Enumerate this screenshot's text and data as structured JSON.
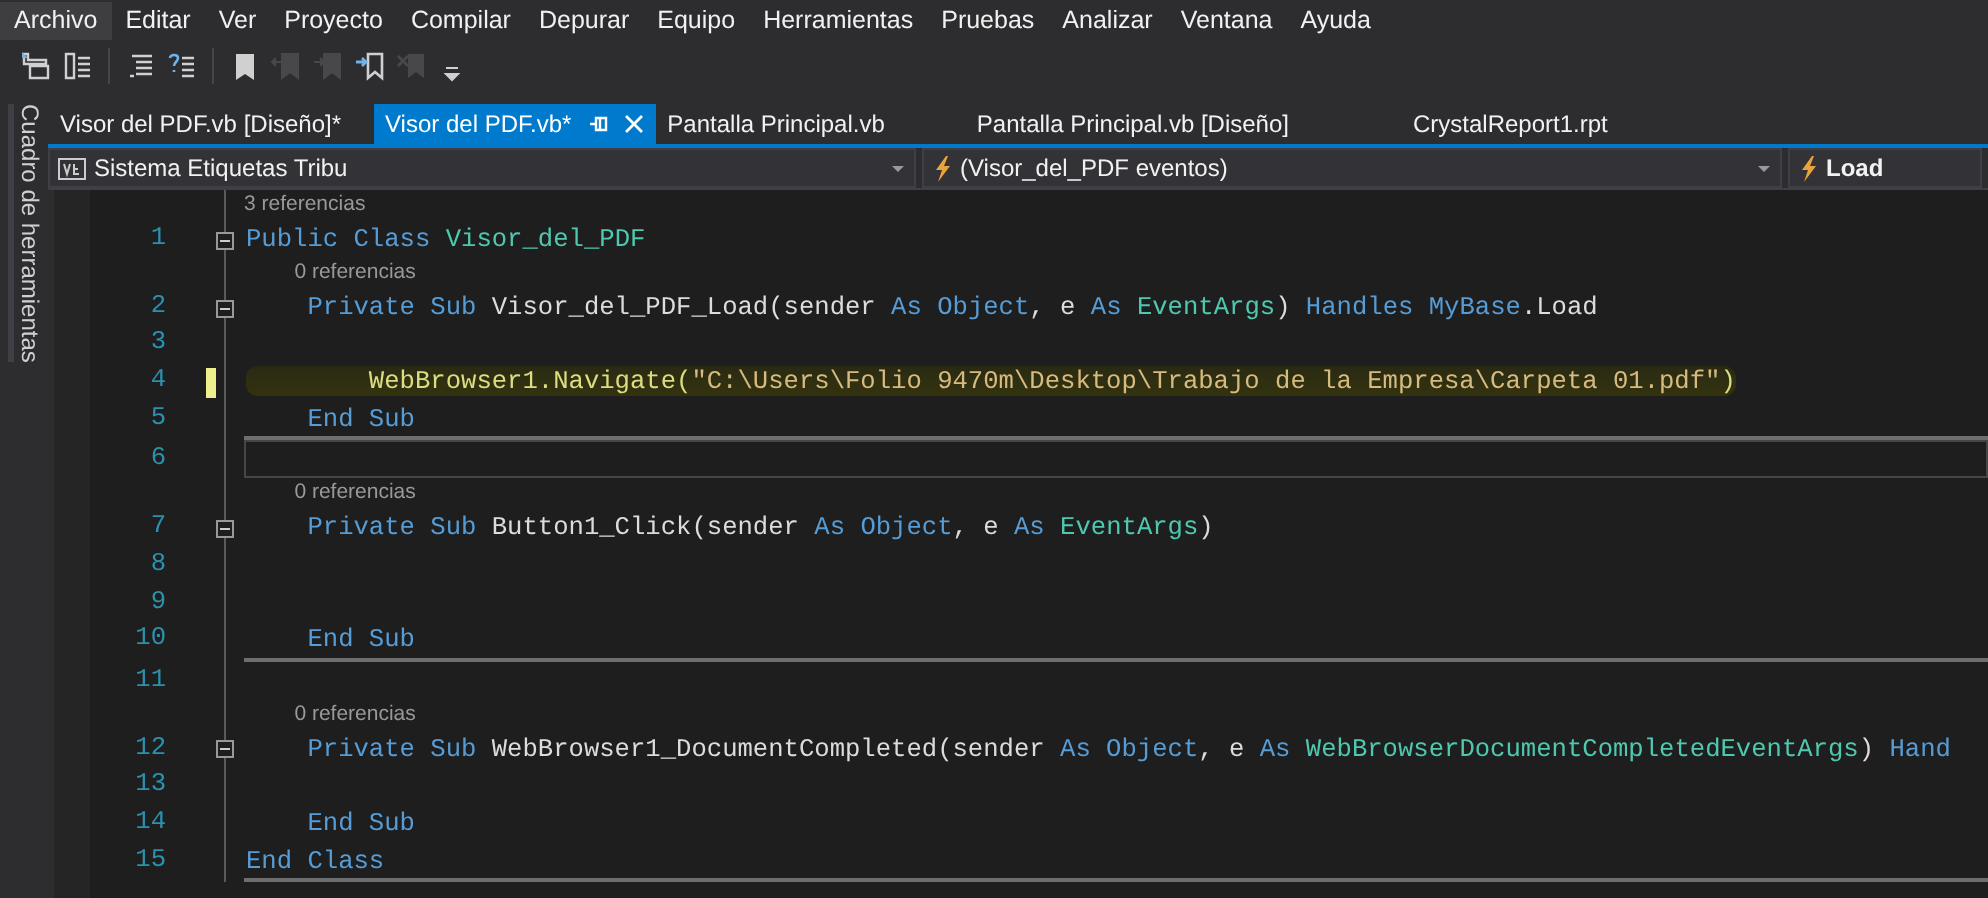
{
  "menu": [
    {
      "label": "Archivo",
      "selected": true
    },
    {
      "label": "Editar",
      "selected": false
    },
    {
      "label": "Ver",
      "selected": false
    },
    {
      "label": "Proyecto",
      "selected": false
    },
    {
      "label": "Compilar",
      "selected": false
    },
    {
      "label": "Depurar",
      "selected": false
    },
    {
      "label": "Equipo",
      "selected": false
    },
    {
      "label": "Herramientas",
      "selected": false
    },
    {
      "label": "Pruebas",
      "selected": false
    },
    {
      "label": "Analizar",
      "selected": false
    },
    {
      "label": "Ventana",
      "selected": false
    },
    {
      "label": "Ayuda",
      "selected": false
    }
  ],
  "toolbar": [
    {
      "kind": "outline",
      "disabled": false
    },
    {
      "kind": "list",
      "disabled": false
    },
    {
      "kind": "comment",
      "disabled": false
    },
    {
      "kind": "uncomment",
      "disabled": false
    },
    {
      "kind": "bookmark",
      "disabled": false
    },
    {
      "kind": "prev-bookmark",
      "disabled": true
    },
    {
      "kind": "next-bookmark",
      "disabled": true
    },
    {
      "kind": "folder-bookmark",
      "disabled": false
    },
    {
      "kind": "clear-bookmark",
      "disabled": true
    },
    {
      "kind": "overflow",
      "disabled": false
    }
  ],
  "side_panel": {
    "title": "Cuadro de herramientas"
  },
  "tabs": [
    {
      "label": "Visor del PDF.vb [Diseño]*",
      "selected": false
    },
    {
      "label": "Visor del PDF.vb*",
      "selected": true
    },
    {
      "label": "Pantalla Principal.vb",
      "selected": false
    },
    {
      "label": "Pantalla Principal.vb [Diseño]",
      "selected": false
    },
    {
      "label": "CrystalReport1.rpt",
      "selected": false
    }
  ],
  "navigation": {
    "project": "Sistema Etiquetas Tribu",
    "object": "(Visor_del_PDF eventos)",
    "member": "Load"
  },
  "editor": {
    "lines": [
      {
        "number": "1",
        "codelens": "3 referencias",
        "fold": true,
        "modified": false,
        "highlighted": false,
        "current": false,
        "separator_after": false,
        "tokens": [
          {
            "kind": "kw",
            "text": "Public Class "
          },
          {
            "kind": "type",
            "text": "Visor_del_PDF"
          }
        ]
      },
      {
        "number": "2",
        "codelens": "0 referencias",
        "fold": true,
        "modified": false,
        "highlighted": false,
        "current": false,
        "separator_after": false,
        "tokens": [
          {
            "kind": "kw",
            "text": "    Private Sub "
          },
          {
            "kind": "plain",
            "text": "Visor_del_PDF_Load(sender "
          },
          {
            "kind": "kw",
            "text": "As Object"
          },
          {
            "kind": "plain",
            "text": ", e "
          },
          {
            "kind": "kw",
            "text": "As "
          },
          {
            "kind": "type",
            "text": "EventArgs"
          },
          {
            "kind": "plain",
            "text": ") "
          },
          {
            "kind": "kw",
            "text": "Handles MyBase"
          },
          {
            "kind": "plain",
            "text": ".Load"
          }
        ]
      },
      {
        "number": "3",
        "fold": false,
        "modified": false,
        "highlighted": false,
        "current": false,
        "separator_after": false
      },
      {
        "number": "4",
        "fold": false,
        "modified": true,
        "highlighted": true,
        "current": false,
        "separator_after": false,
        "tokens": [
          {
            "kind": "plain",
            "text": "        WebBrowser1.Navigate("
          },
          {
            "kind": "str",
            "text": "\"C:\\Users\\Folio 9470m\\Desktop\\Trabajo de la Empresa\\Carpeta 01.pdf\""
          },
          {
            "kind": "plain",
            "text": ")"
          }
        ]
      },
      {
        "number": "5",
        "fold": false,
        "modified": false,
        "highlighted": false,
        "current": false,
        "separator_after": true,
        "tokens": [
          {
            "kind": "kw",
            "text": "    End Sub"
          }
        ]
      },
      {
        "number": "6",
        "fold": false,
        "modified": false,
        "highlighted": false,
        "current": true,
        "separator_after": false
      },
      {
        "number": "7",
        "codelens": "0 referencias",
        "fold": true,
        "modified": false,
        "highlighted": false,
        "current": false,
        "separator_after": false,
        "tokens": [
          {
            "kind": "kw",
            "text": "    Private Sub "
          },
          {
            "kind": "plain",
            "text": "Button1_Click(sender "
          },
          {
            "kind": "kw",
            "text": "As Object"
          },
          {
            "kind": "plain",
            "text": ", e "
          },
          {
            "kind": "kw",
            "text": "As "
          },
          {
            "kind": "type",
            "text": "EventArgs"
          },
          {
            "kind": "plain",
            "text": ")"
          }
        ]
      },
      {
        "number": "8",
        "fold": false,
        "modified": false,
        "highlighted": false,
        "current": false,
        "separator_after": false
      },
      {
        "number": "9",
        "fold": false,
        "modified": false,
        "highlighted": false,
        "current": false,
        "separator_after": false
      },
      {
        "number": "10",
        "fold": false,
        "modified": false,
        "highlighted": false,
        "current": false,
        "separator_after": true,
        "tokens": [
          {
            "kind": "kw",
            "text": "    End Sub"
          }
        ]
      },
      {
        "number": "11",
        "fold": false,
        "modified": false,
        "highlighted": false,
        "current": false,
        "separator_after": false
      },
      {
        "number": "12",
        "codelens": "0 referencias",
        "fold": true,
        "modified": false,
        "highlighted": false,
        "current": false,
        "separator_after": false,
        "tokens": [
          {
            "kind": "kw",
            "text": "    Private Sub "
          },
          {
            "kind": "plain",
            "text": "WebBrowser1_DocumentCompleted(sender "
          },
          {
            "kind": "kw",
            "text": "As Object"
          },
          {
            "kind": "plain",
            "text": ", e "
          },
          {
            "kind": "kw",
            "text": "As "
          },
          {
            "kind": "type",
            "text": "WebBrowserDocumentCompletedEventArgs"
          },
          {
            "kind": "plain",
            "text": ") "
          },
          {
            "kind": "kw",
            "text": "Hand"
          }
        ]
      },
      {
        "number": "13",
        "fold": false,
        "modified": false,
        "highlighted": false,
        "current": false,
        "separator_after": false
      },
      {
        "number": "14",
        "fold": false,
        "modified": false,
        "highlighted": false,
        "current": false,
        "separator_after": false,
        "tokens": [
          {
            "kind": "kw",
            "text": "    End Sub"
          }
        ]
      },
      {
        "number": "15",
        "fold": false,
        "modified": false,
        "highlighted": false,
        "current": false,
        "separator_after": true,
        "tokens": [
          {
            "kind": "kw",
            "text": "End Class"
          }
        ]
      }
    ]
  }
}
